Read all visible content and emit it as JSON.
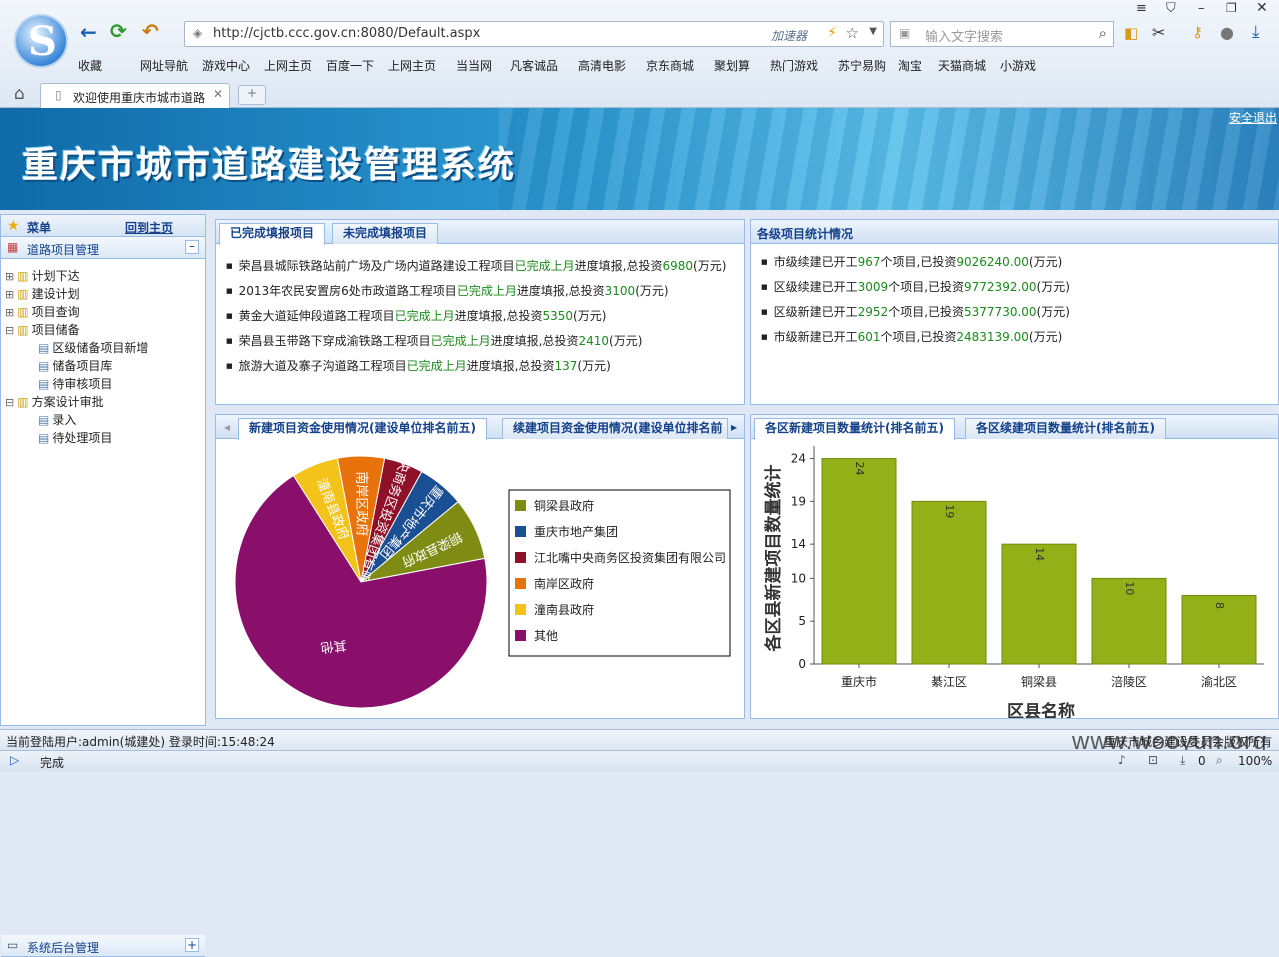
{
  "browser": {
    "url": "http://cjctb.ccc.gov.cn:8080/Default.aspx",
    "accelerator": "加速器",
    "search_placeholder": "输入文字搜索",
    "bookmarks": [
      "收藏",
      "网址导航",
      "游戏中心",
      "上网主页",
      "百度一下",
      "上网主页",
      "当当网",
      "凡客诚品",
      "高清电影",
      "京东商城",
      "聚划算",
      "热门游戏",
      "苏宁易购",
      "淘宝",
      "天猫商城",
      "小游戏"
    ],
    "tab_title": "欢迎使用重庆市城市道路",
    "status_text": "完成",
    "zoom": "100%",
    "status_count": "0"
  },
  "banner": {
    "title": "重庆市城市道路建设管理系统",
    "logout": "安全退出"
  },
  "sidebar": {
    "menu_label": "菜单",
    "home_link": "回到主页",
    "section1": "道路项目管理",
    "section2": "系统后台管理",
    "tree": [
      {
        "label": "计划下达",
        "level": 0
      },
      {
        "label": "建设计划",
        "level": 0
      },
      {
        "label": "项目查询",
        "level": 0
      },
      {
        "label": "项目储备",
        "level": 0
      },
      {
        "label": "区级储备项目新增",
        "level": 1
      },
      {
        "label": "储备项目库",
        "level": 1
      },
      {
        "label": "待审核项目",
        "level": 1
      },
      {
        "label": "方案设计审批",
        "level": 0
      },
      {
        "label": "录入",
        "level": 1
      },
      {
        "label": "待处理项目",
        "level": 1
      }
    ]
  },
  "completed": {
    "tab_active": "已完成填报项目",
    "tab_other": "未完成填报项目",
    "items": [
      {
        "pre": "荣昌县城际铁路站前广场及广场内道路建设工程项目",
        "done": "已完成上月",
        "mid": "进度填报,总投资",
        "amt": "6980",
        "unit": "(万元)"
      },
      {
        "pre": "2013年农民安置房6处市政道路工程项目",
        "done": "已完成上月",
        "mid": "进度填报,总投资",
        "amt": "3100",
        "unit": "(万元)"
      },
      {
        "pre": "黄金大道延伸段道路工程项目",
        "done": "已完成上月",
        "mid": "进度填报,总投资",
        "amt": "5350",
        "unit": "(万元)"
      },
      {
        "pre": "荣昌县玉带路下穿成渝铁路工程项目",
        "done": "已完成上月",
        "mid": "进度填报,总投资",
        "amt": "2410",
        "unit": "(万元)"
      },
      {
        "pre": "旅游大道及寨子沟道路工程项目",
        "done": "已完成上月",
        "mid": "进度填报,总投资",
        "amt": "137",
        "unit": "(万元)"
      }
    ]
  },
  "stats": {
    "title": "各级项目统计情况",
    "items": [
      {
        "pre": "市级续建已开工",
        "count": "967",
        "mid": "个项目,已投资",
        "amt": "9026240.00",
        "unit": "(万元)"
      },
      {
        "pre": "区级续建已开工",
        "count": "3009",
        "mid": "个项目,已投资",
        "amt": "9772392.00",
        "unit": "(万元)"
      },
      {
        "pre": "区级新建已开工",
        "count": "2952",
        "mid": "个项目,已投资",
        "amt": "5377730.00",
        "unit": "(万元)"
      },
      {
        "pre": "市级新建已开工",
        "count": "601",
        "mid": "个项目,已投资",
        "amt": "2483139.00",
        "unit": "(万元)"
      }
    ]
  },
  "pie_panel": {
    "tab_active": "新建项目资金使用情况(建设单位排名前五)",
    "tab_other": "续建项目资金使用情况(建设单位排名前"
  },
  "bar_panel": {
    "tab_active": "各区新建项目数量统计(排名前五)",
    "tab_other": "各区续建项目数量统计(排名前五)"
  },
  "chart_data": [
    {
      "type": "pie",
      "labels": [
        "铜梁县政府",
        "重庆市地产集团",
        "江北嘴中央商务区投资集团有限公司",
        "南岸区政府",
        "潼南县政府",
        "其他"
      ],
      "values": [
        8,
        6,
        5,
        6,
        6,
        69
      ],
      "colors": [
        "#7e8c13",
        "#1a4f93",
        "#8e1029",
        "#e8720c",
        "#f3c319",
        "#8a0f6b"
      ],
      "legend_position": "right"
    },
    {
      "type": "bar",
      "categories": [
        "重庆市",
        "綦江区",
        "铜梁县",
        "涪陵区",
        "渝北区"
      ],
      "values": [
        24,
        19,
        14,
        10,
        8
      ],
      "xlabel": "区县名称",
      "ylabel": "各区县新建项目数量统计",
      "yticks": [
        0,
        5,
        10,
        14,
        19,
        24
      ],
      "ylim": [
        0,
        25
      ],
      "color": "#93b019",
      "grid": false
    }
  ],
  "footer": {
    "user_info": "当前登陆用户:admin(城建处)   登录时间:15:48:24",
    "copyright": "重庆市城乡建设委员会版权所有",
    "watermark": "www.wooyun.org"
  }
}
